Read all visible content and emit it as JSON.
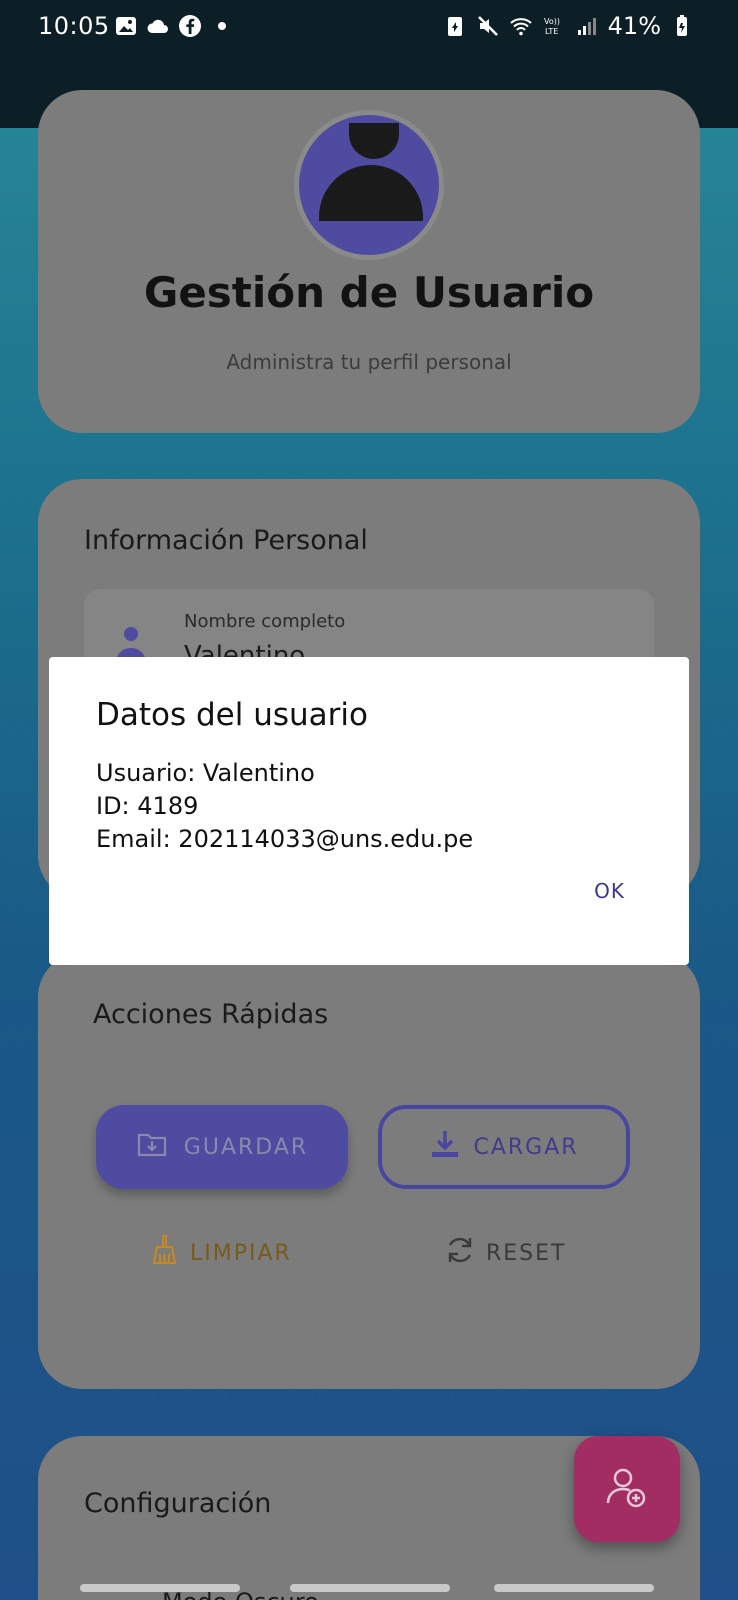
{
  "status_bar": {
    "time": "10:05",
    "battery": "41%",
    "icons_left": [
      "gallery-icon",
      "cloud-icon",
      "facebook-icon",
      "dot-icon"
    ],
    "icons_right": [
      "battery-saver-icon",
      "mute-icon",
      "wifi-icon",
      "volte-icon",
      "signal-icon",
      "battery-icon"
    ]
  },
  "profile_card": {
    "title": "Gestión de Usuario",
    "subtitle": "Administra tu perfil personal"
  },
  "info_card": {
    "heading": "Información Personal",
    "field_label": "Nombre completo",
    "field_value": "Valentino"
  },
  "actions_card": {
    "heading": "Acciones Rápidas",
    "save_label": "GUARDAR",
    "load_label": "CARGAR",
    "clear_label": "LIMPIAR",
    "reset_label": "RESET"
  },
  "config_card": {
    "heading": "Configuración",
    "dark_mode_label": "Modo Oscuro"
  },
  "dialog": {
    "title": "Datos del usuario",
    "user_line": "Usuario: Valentino",
    "id_line": "ID: 4189",
    "email_line": "Email: 202114033@uns.edu.pe",
    "ok_label": "OK"
  },
  "colors": {
    "accent": "#4f4ba0",
    "fab": "#a22d63",
    "clear": "#c88a1e"
  }
}
